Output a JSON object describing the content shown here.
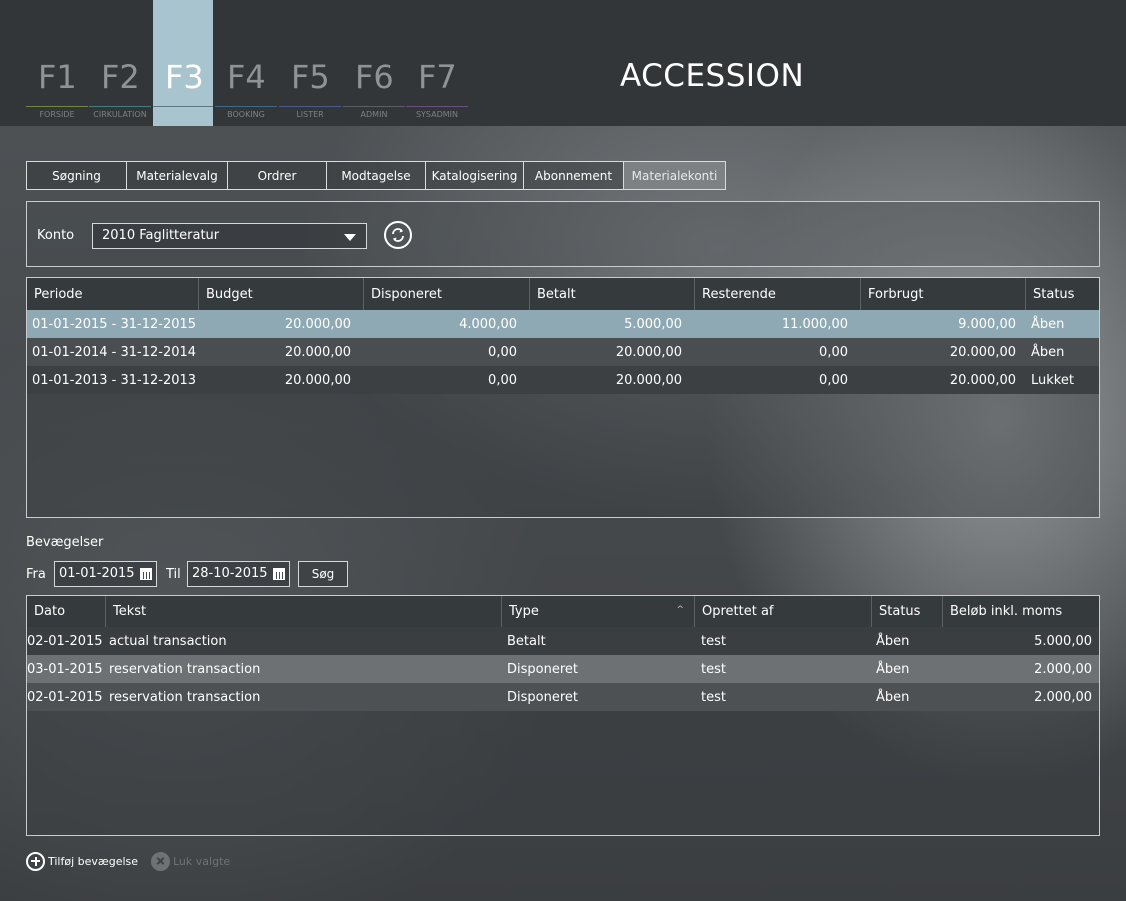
{
  "header": {
    "app_title": "ACCESSION",
    "fkeys": [
      {
        "key": "F1",
        "label": "FORSIDE",
        "color": "#6f8a3a",
        "active": false
      },
      {
        "key": "F2",
        "label": "CIRKULATION",
        "color": "#3f7f80",
        "active": false
      },
      {
        "key": "F3",
        "label": "",
        "color": "#a8c4cf",
        "active": true
      },
      {
        "key": "F4",
        "label": "BOOKING",
        "color": "#3e6a8a",
        "active": false
      },
      {
        "key": "F5",
        "label": "LISTER",
        "color": "#4a5a8a",
        "active": false
      },
      {
        "key": "F6",
        "label": "ADMIN",
        "color": "#5a5f63",
        "active": false
      },
      {
        "key": "F7",
        "label": "SYSADMIN",
        "color": "#6a5080",
        "active": false
      }
    ]
  },
  "tabs": [
    {
      "label": "Søgning",
      "active": false
    },
    {
      "label": "Materialevalg",
      "active": false
    },
    {
      "label": "Ordrer",
      "active": false
    },
    {
      "label": "Modtagelse",
      "active": false
    },
    {
      "label": "Katalogisering",
      "active": false
    },
    {
      "label": "Abonnement",
      "active": false
    },
    {
      "label": "Materialekonti",
      "active": true
    }
  ],
  "konto": {
    "label": "Konto",
    "selected": "2010 Faglitteratur",
    "refresh_icon": "refresh-icon"
  },
  "periods": {
    "columns": [
      "Periode",
      "Budget",
      "Disponeret",
      "Betalt",
      "Resterende",
      "Forbrugt",
      "Status"
    ],
    "rows": [
      {
        "periode": "01-01-2015 - 31-12-2015",
        "budget": "20.000,00",
        "disponeret": "4.000,00",
        "betalt": "5.000,00",
        "resterende": "11.000,00",
        "forbrugt": "9.000,00",
        "status": "Åben",
        "selected": true
      },
      {
        "periode": "01-01-2014 - 31-12-2014",
        "budget": "20.000,00",
        "disponeret": "0,00",
        "betalt": "20.000,00",
        "resterende": "0,00",
        "forbrugt": "20.000,00",
        "status": "Åben",
        "selected": false
      },
      {
        "periode": "01-01-2013 - 31-12-2013",
        "budget": "20.000,00",
        "disponeret": "0,00",
        "betalt": "20.000,00",
        "resterende": "0,00",
        "forbrugt": "20.000,00",
        "status": "Lukket",
        "selected": false
      }
    ]
  },
  "movements": {
    "title": "Bevægelser",
    "from_label": "Fra",
    "from_value": "01-01-2015",
    "to_label": "Til",
    "to_value": "28-10-2015",
    "search_label": "Søg",
    "sort_indicator": "^",
    "columns": [
      "Dato",
      "Tekst",
      "Type",
      "Oprettet af",
      "Status",
      "Beløb inkl. moms"
    ],
    "rows": [
      {
        "dato": "02-01-2015",
        "tekst": "actual transaction",
        "type": "Betalt",
        "oprettet": "test",
        "status": "Åben",
        "beloeb": "5.000,00"
      },
      {
        "dato": "03-01-2015",
        "tekst": "reservation transaction",
        "type": "Disponeret",
        "oprettet": "test",
        "status": "Åben",
        "beloeb": "2.000,00"
      },
      {
        "dato": "02-01-2015",
        "tekst": "reservation transaction",
        "type": "Disponeret",
        "oprettet": "test",
        "status": "Åben",
        "beloeb": "2.000,00"
      }
    ]
  },
  "actions": {
    "add_label": "Tilføj bevægelse",
    "close_label": "Luk valgte"
  },
  "colors": {
    "selected_row": "#8ea9b4",
    "row_a": "#3a3e41",
    "row_b": "#4a4e51",
    "disabled_text": "#6e7275"
  }
}
